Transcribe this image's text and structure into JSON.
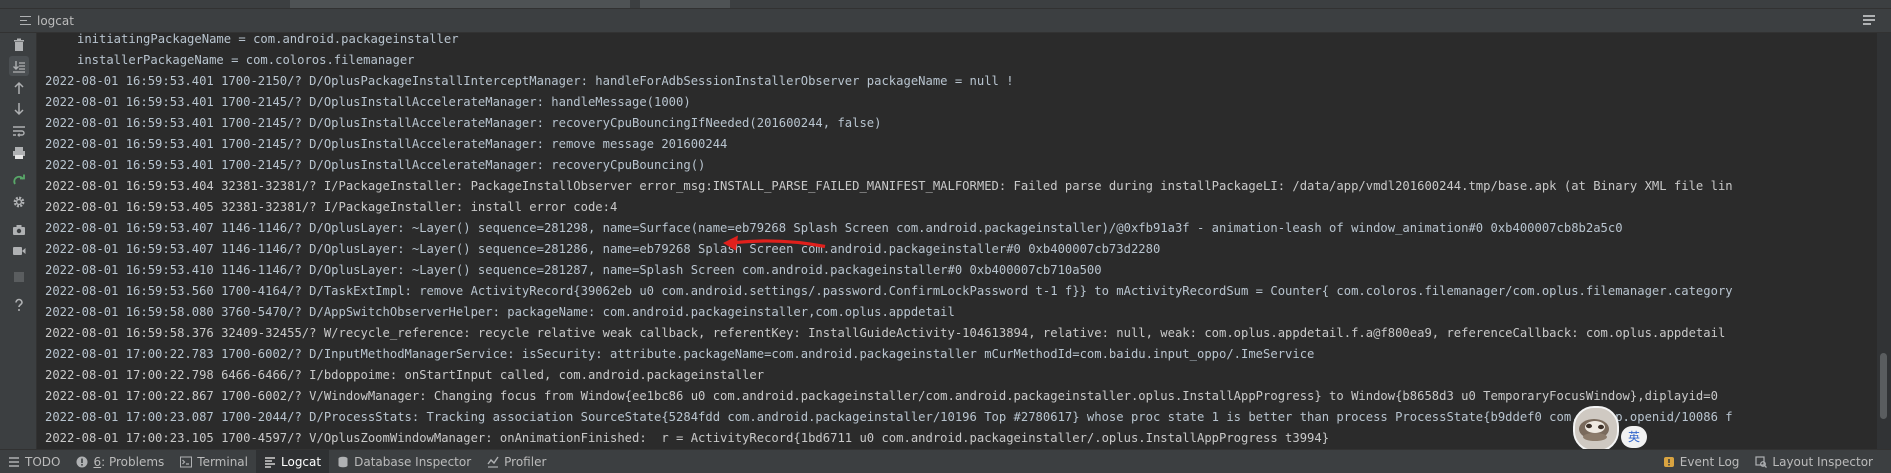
{
  "panel": {
    "title": "logcat"
  },
  "log_lines": [
    {
      "text": "initiatingPackageName = com.android.packageinstaller",
      "indent": true,
      "level": "D"
    },
    {
      "text": "installerPackageName = com.coloros.filemanager",
      "indent": true,
      "level": "D"
    },
    {
      "text": "2022-08-01 16:59:53.401 1700-2150/? D/OplusPackageInstallInterceptManager: handleForAdbSessionInstallerObserver packageName = null !",
      "level": "D"
    },
    {
      "text": "2022-08-01 16:59:53.401 1700-2145/? D/OplusInstallAccelerateManager: handleMessage(1000)",
      "level": "D"
    },
    {
      "text": "2022-08-01 16:59:53.401 1700-2145/? D/OplusInstallAccelerateManager: recoveryCpuBouncingIfNeeded(201600244, false)",
      "level": "D"
    },
    {
      "text": "2022-08-01 16:59:53.401 1700-2145/? D/OplusInstallAccelerateManager: remove message 201600244",
      "level": "D"
    },
    {
      "text": "2022-08-01 16:59:53.401 1700-2145/? D/OplusInstallAccelerateManager: recoveryCpuBouncing()",
      "level": "D"
    },
    {
      "text": "2022-08-01 16:59:53.404 32381-32381/? I/PackageInstaller: PackageInstallObserver error_msg:INSTALL_PARSE_FAILED_MANIFEST_MALFORMED: Failed parse during installPackageLI: /data/app/vmdl201600244.tmp/base.apk (at Binary XML file lin",
      "level": "I"
    },
    {
      "text": "2022-08-01 16:59:53.405 32381-32381/? I/PackageInstaller: install error code:4",
      "level": "I"
    },
    {
      "text": "2022-08-01 16:59:53.407 1146-1146/? D/OplusLayer: ~Layer() sequence=281298, name=Surface(name=eb79268 Splash Screen com.android.packageinstaller)/@0xfb91a3f - animation-leash of window_animation#0 0xb400007cb8b2a5c0",
      "level": "D"
    },
    {
      "text": "2022-08-01 16:59:53.407 1146-1146/? D/OplusLayer: ~Layer() sequence=281286, name=eb79268 Splash Screen com.android.packageinstaller#0 0xb400007cb73d2280",
      "level": "D"
    },
    {
      "text": "2022-08-01 16:59:53.410 1146-1146/? D/OplusLayer: ~Layer() sequence=281287, name=Splash Screen com.android.packageinstaller#0 0xb400007cb710a500",
      "level": "D"
    },
    {
      "text": "2022-08-01 16:59:53.560 1700-4164/? D/TaskExtImpl: remove ActivityRecord{39062eb u0 com.android.settings/.password.ConfirmLockPassword t-1 f}} to mActivityRecordSum = Counter{ com.coloros.filemanager/com.oplus.filemanager.category",
      "level": "D"
    },
    {
      "text": "2022-08-01 16:59:58.080 3760-5470/? D/AppSwitchObserverHelper: packageName: com.android.packageinstaller,com.oplus.appdetail",
      "level": "D"
    },
    {
      "text": "2022-08-01 16:59:58.376 32409-32455/? W/recycle_reference: recycle relative weak callback, referentKey: InstallGuideActivity-104613894, relative: null, weak: com.oplus.appdetail.f.a@f800ea9, referenceCallback: com.oplus.appdetail",
      "level": "W"
    },
    {
      "text": "2022-08-01 17:00:22.783 1700-6002/? D/InputMethodManagerService: isSecurity: attribute.packageName=com.android.packageinstaller mCurMethodId=com.baidu.input_oppo/.ImeService",
      "level": "D"
    },
    {
      "text": "2022-08-01 17:00:22.798 6466-6466/? I/bdoppoime: onStartInput called, com.android.packageinstaller",
      "level": "I"
    },
    {
      "text": "2022-08-01 17:00:22.867 1700-6002/? V/WindowManager: Changing focus from Window{ee1bc86 u0 com.android.packageinstaller/com.android.packageinstaller.oplus.InstallAppProgress} to Window{b8658d3 u0 TemporaryFocusWindow},diplayid=0",
      "level": "V"
    },
    {
      "text": "2022-08-01 17:00:23.087 1700-2044/? D/ProcessStats: Tracking association SourceState{5284fdd com.android.packageinstaller/10196 Top #2780617} whose proc state 1 is better than process ProcessState{b9ddef0 com.heytap.openid/10086 f",
      "level": "D"
    },
    {
      "text": "2022-08-01 17:00:23.105 1700-4597/? V/OplusZoomWindowManager: onAnimationFinished:  r = ActivityRecord{1bd6711 u0 com.android.packageinstaller/.oplus.InstallAppProgress t3994}",
      "level": "V"
    }
  ],
  "ime_badge": "英",
  "bottom_tabs": [
    {
      "label": "TODO",
      "icon": "list-icon"
    },
    {
      "num": "6",
      "label": ": Problems",
      "icon": "warning-icon"
    },
    {
      "label": "Terminal",
      "icon": "terminal-icon"
    },
    {
      "label": "Logcat",
      "icon": "logcat-icon",
      "selected": true
    },
    {
      "label": "Database Inspector",
      "icon": "database-icon"
    },
    {
      "label": "Profiler",
      "icon": "profiler-icon"
    }
  ],
  "right_tabs": [
    {
      "label": "Event Log",
      "icon": "event-log-icon"
    },
    {
      "label": "Layout Inspector",
      "icon": "layout-inspector-icon"
    }
  ],
  "colors": {
    "background": "#2b2b2b",
    "toolbar": "#3c3f41",
    "text": "#a9b7c6",
    "annotation_arrow": "#e0201c"
  }
}
